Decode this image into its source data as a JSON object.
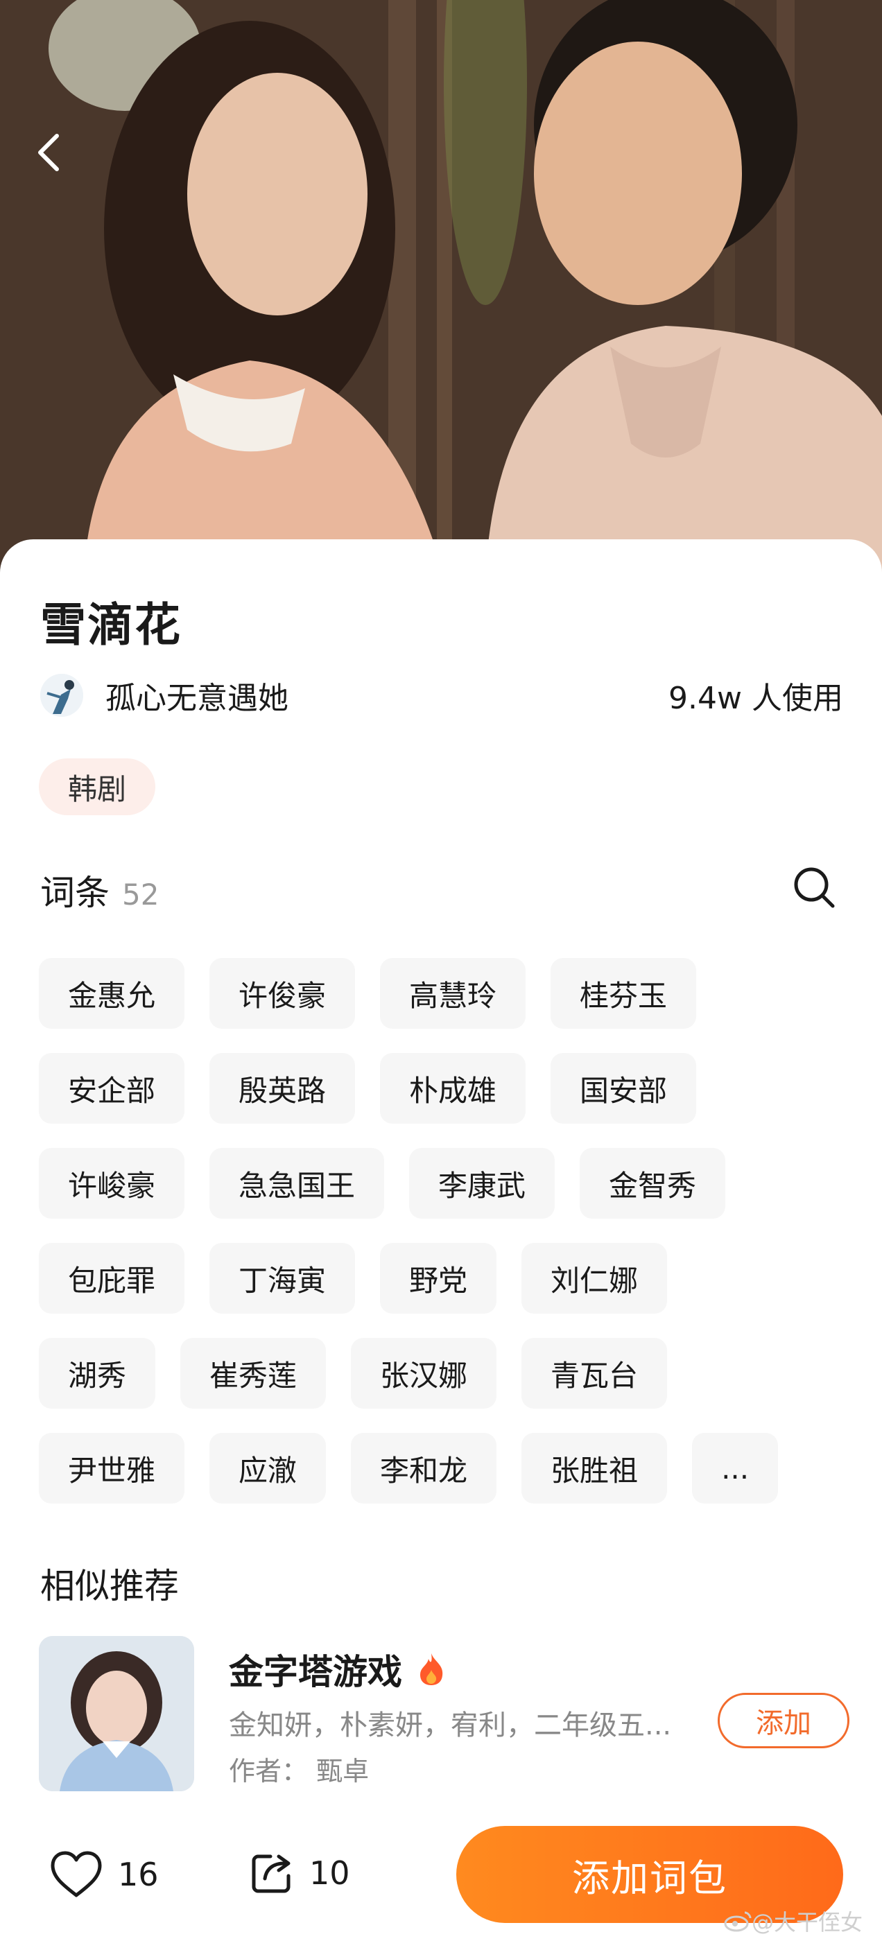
{
  "header": {
    "back_icon": "chevron-left-icon"
  },
  "pack": {
    "title": "雪滴花",
    "author_name": "孤心无意遇她",
    "usage": "9.4w 人使用",
    "genre_tag": "韩剧"
  },
  "terms": {
    "title": "词条",
    "count": "52",
    "rows": [
      [
        "金惠允",
        "许俊豪",
        "高慧玲",
        "桂芬玉"
      ],
      [
        "安企部",
        "殷英路",
        "朴成雄",
        "国安部"
      ],
      [
        "许峻豪",
        "急急国王",
        "李康武",
        "金智秀"
      ],
      [
        "包庇罪",
        "丁海寅",
        "野党",
        "刘仁娜"
      ],
      [
        "湖秀",
        "崔秀莲",
        "张汉娜",
        "青瓦台"
      ],
      [
        "尹世雅",
        "应澈",
        "李和龙",
        "张胜祖",
        "..."
      ]
    ]
  },
  "similar": {
    "title": "相似推荐",
    "items": [
      {
        "name": "金字塔游戏",
        "members": "金知妍，朴素妍，宥利，二年级五...",
        "author": "作者：  甄卓",
        "add_label": "添加"
      }
    ]
  },
  "bottom": {
    "like_count": "16",
    "share_count": "10",
    "add_pack_label": "添加词包"
  },
  "watermark": "@大干侄女",
  "colors": {
    "accent": "#ff7a1f",
    "tag_bg": "#fdeeea",
    "chip_bg": "#f6f6f6"
  }
}
